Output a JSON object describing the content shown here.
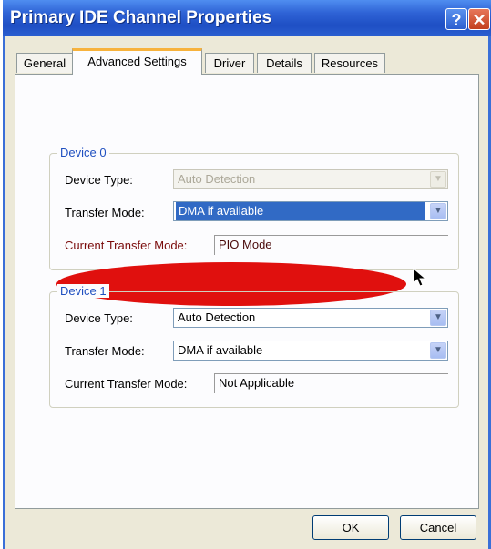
{
  "window": {
    "title": "Primary IDE Channel Properties",
    "help_glyph": "?",
    "close_glyph": "✕"
  },
  "tabs": [
    {
      "label": "General",
      "active": false
    },
    {
      "label": "Advanced Settings",
      "active": true
    },
    {
      "label": "Driver",
      "active": false
    },
    {
      "label": "Details",
      "active": false
    },
    {
      "label": "Resources",
      "active": false
    }
  ],
  "device0": {
    "group_label": "Device 0",
    "device_type_label": "Device Type:",
    "device_type_value": "Auto Detection",
    "transfer_mode_label": "Transfer Mode:",
    "transfer_mode_value": "DMA if available",
    "current_mode_label": "Current Transfer Mode:",
    "current_mode_value": "PIO Mode"
  },
  "device1": {
    "group_label": "Device 1",
    "device_type_label": "Device Type:",
    "device_type_value": "Auto Detection",
    "transfer_mode_label": "Transfer Mode:",
    "transfer_mode_value": "DMA if available",
    "current_mode_label": "Current Transfer Mode:",
    "current_mode_value": "Not Applicable"
  },
  "buttons": {
    "ok": "OK",
    "cancel": "Cancel"
  },
  "icons": {
    "dropdown": "chevron-down-icon",
    "cursor": "mouse-pointer-icon"
  },
  "colors": {
    "titlebar": "#2f63d6",
    "dialog_bg": "#ece9d8",
    "selection": "#316ac5",
    "highlight_ellipse": "#e0100e",
    "group_label": "#2050c0"
  }
}
